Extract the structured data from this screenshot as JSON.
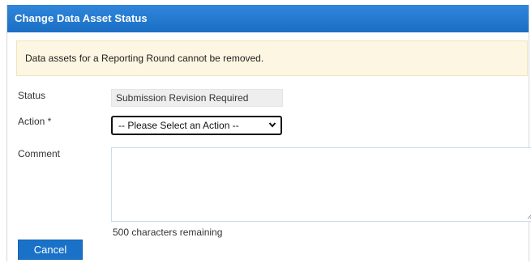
{
  "dialog": {
    "title": "Change Data Asset Status",
    "notice": "Data assets for a Reporting Round cannot be removed."
  },
  "form": {
    "status_label": "Status",
    "status_value": "Submission Revision Required",
    "action_label": "Action *",
    "action_selected": "-- Please Select an Action --",
    "comment_label": "Comment",
    "comment_value": "",
    "chars_remaining": "500 characters remaining"
  },
  "buttons": {
    "cancel_label": "Cancel"
  },
  "colors": {
    "header_blue": "#1a6fc4",
    "notice_bg": "#fcf6e2",
    "button_blue": "#1a72c8"
  }
}
